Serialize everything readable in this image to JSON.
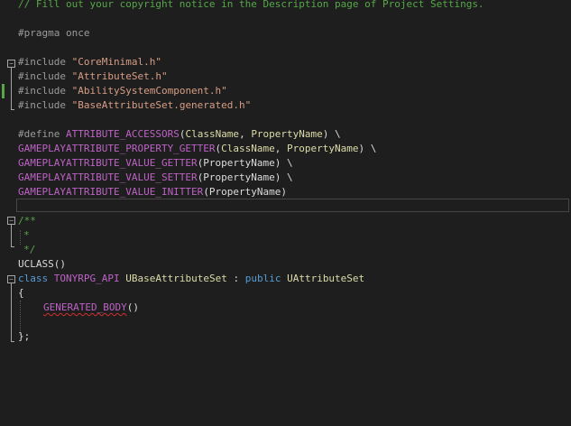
{
  "editor": {
    "lines": {
      "l1": "// Fill out your copyright notice in the Description page of Project Settings.",
      "pragma": "#pragma once",
      "inc_kw": "#include",
      "inc1": "\"CoreMinimal.h\"",
      "inc2": "\"AttributeSet.h\"",
      "inc3": "\"AbilitySystemComponent.h\"",
      "inc4": "\"BaseAttributeSet.generated.h\"",
      "define_kw": "#define",
      "define_macro": "ATTRIBUTE_ACCESSORS",
      "define_open": "(",
      "define_p1": "ClassName",
      "define_comma": ", ",
      "define_p2": "PropertyName",
      "define_close": ") \\",
      "m1_name": "GAMEPLAYATTRIBUTE_PROPERTY_GETTER",
      "m1_open": "(",
      "m1_p1": "ClassName",
      "m1_comma": ", ",
      "m1_p2": "PropertyName",
      "m1_close": ") \\",
      "m2_name": "GAMEPLAYATTRIBUTE_VALUE_GETTER",
      "m2_args": "(PropertyName) \\",
      "m3_name": "GAMEPLAYATTRIBUTE_VALUE_SETTER",
      "m3_args": "(PropertyName) \\",
      "m4_name": "GAMEPLAYATTRIBUTE_VALUE_INITTER",
      "m4_args": "(PropertyName)",
      "doc_open": "/**",
      "doc_mid": "*",
      "doc_close": "*/",
      "uclass": "UCLASS",
      "uclass_args": "()",
      "class_kw": "class",
      "class_api": "TONYRPG_API",
      "class_name": "UBaseAttributeSet",
      "class_colon": " : ",
      "class_public": "public",
      "class_base": "UAttributeSet",
      "brace_open": "{",
      "gen_body": "GENERATED_BODY",
      "gen_args": "()",
      "brace_close": "};"
    }
  }
}
